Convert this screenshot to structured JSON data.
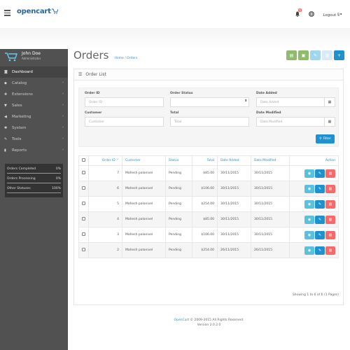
{
  "brand": {
    "name": "opencart"
  },
  "topbar": {
    "notification_count": "6",
    "logout_label": "Logout"
  },
  "user": {
    "name": "John Doe",
    "role": "Administrator"
  },
  "nav": [
    {
      "label": "Dashboard",
      "icon": "dashboard-icon",
      "active": true
    },
    {
      "label": "Catalog",
      "icon": "tag-icon"
    },
    {
      "label": "Extensions",
      "icon": "puzzle-icon"
    },
    {
      "label": "Sales",
      "icon": "cart-icon"
    },
    {
      "label": "Marketing",
      "icon": "share-icon"
    },
    {
      "label": "System",
      "icon": "cog-icon"
    },
    {
      "label": "Tools",
      "icon": "wrench-icon"
    },
    {
      "label": "Reports",
      "icon": "chart-icon"
    }
  ],
  "stats": [
    {
      "label": "Orders Completed",
      "value": "0%",
      "level": 0
    },
    {
      "label": "Orders Processing",
      "value": "0%",
      "level": 0
    },
    {
      "label": "Other Statuses",
      "value": "100%",
      "level": 1
    }
  ],
  "header": {
    "title": "Orders",
    "breadcrumb_home": "Home",
    "breadcrumb_sep": "/",
    "breadcrumb_current": "Orders"
  },
  "action_buttons": [
    {
      "name": "print-invoice-button",
      "color": "#8fbb6c",
      "icon": "print-icon"
    },
    {
      "name": "print-shipping-button",
      "color": "#8fbb6c",
      "icon": "truck-icon"
    },
    {
      "name": "edit-button",
      "color": "#a1d7ee",
      "icon": "pencil-icon"
    },
    {
      "name": "delete-button",
      "color": "#d7eaf6",
      "icon": "trash-icon"
    },
    {
      "name": "add-button",
      "color": "#1e91cf",
      "icon": "plus-icon"
    }
  ],
  "panel": {
    "title": "Order List"
  },
  "filter": {
    "order_id": {
      "label": "Order ID",
      "placeholder": "Order ID"
    },
    "order_status": {
      "label": "Order Status",
      "value": ""
    },
    "date_added": {
      "label": "Date Added",
      "placeholder": "Date Added"
    },
    "customer": {
      "label": "Customer",
      "placeholder": "Customer"
    },
    "total": {
      "label": "Total",
      "placeholder": "Total"
    },
    "date_modified": {
      "label": "Date Modified",
      "placeholder": "Date Modified"
    },
    "button_label": "Filter"
  },
  "table": {
    "headers": {
      "order_id": "Order ID",
      "customer": "Customer",
      "status": "Status",
      "total": "Total",
      "date_added": "Date Added",
      "date_modified": "Date Modified",
      "action": "Action"
    },
    "rows": [
      {
        "order_id": "7",
        "customer": "Mahesh palanivel",
        "status": "Pending",
        "total": "$85.00",
        "date_added": "30/11/2015",
        "date_modified": "30/11/2015"
      },
      {
        "order_id": "6",
        "customer": "Mahesh palanivel",
        "status": "Pending",
        "total": "$106.00",
        "date_added": "30/11/2015",
        "date_modified": "30/11/2015"
      },
      {
        "order_id": "5",
        "customer": "Mahesh palanivel",
        "status": "Pending",
        "total": "$254.00",
        "date_added": "30/11/2015",
        "date_modified": "30/11/2015"
      },
      {
        "order_id": "4",
        "customer": "Mahesh palanivel",
        "status": "Pending",
        "total": "$85.00",
        "date_added": "30/11/2015",
        "date_modified": "30/11/2015"
      },
      {
        "order_id": "3",
        "customer": "Mahesh palanivel",
        "status": "Pending",
        "total": "$106.00",
        "date_added": "30/11/2015",
        "date_modified": "30/11/2015"
      },
      {
        "order_id": "2",
        "customer": "Mahesh palanivel",
        "status": "Pending",
        "total": "$254.00",
        "date_added": "26/11/2015",
        "date_modified": "26/11/2015"
      }
    ]
  },
  "pagination": {
    "text": "Showing 1 to 6 of 6 (1 Pages)"
  },
  "footer": {
    "link": "OpenCart",
    "copyright": "© 2009-2015 All Rights Reserved.",
    "version": "Version 2.0.2.0"
  },
  "colors": {
    "accent": "#1e91cf",
    "danger": "#f56b6b",
    "success": "#8fbb6c",
    "sidebar": "#515151",
    "info": "#5bc0de"
  }
}
